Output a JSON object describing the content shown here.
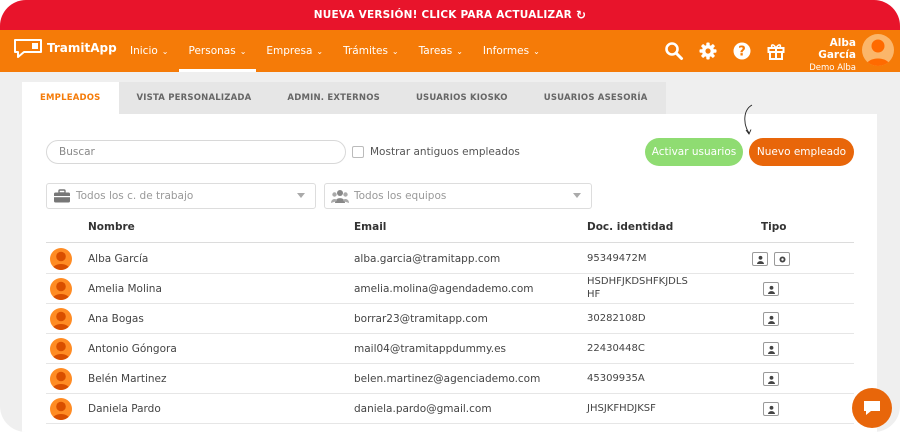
{
  "banner": {
    "text": "NUEVA VERSIÓN! CLICK PARA ACTUALIZAR",
    "icon": "refresh-icon"
  },
  "nav": {
    "logo_text": "TramitApp",
    "menu": [
      {
        "label": "Inicio"
      },
      {
        "label": "Personas",
        "active": true
      },
      {
        "label": "Empresa"
      },
      {
        "label": "Trámites"
      },
      {
        "label": "Tareas"
      },
      {
        "label": "Informes"
      }
    ],
    "icons": [
      "search-icon",
      "gear-icon",
      "help-icon",
      "gift-icon"
    ],
    "user": {
      "name": "Alba García",
      "company": "Demo Alba"
    }
  },
  "tabs": [
    {
      "label": "EMPLEADOS",
      "active": true
    },
    {
      "label": "VISTA PERSONALIZADA"
    },
    {
      "label": "ADMIN. EXTERNOS"
    },
    {
      "label": "USUARIOS KIOSKO"
    },
    {
      "label": "USUARIOS ASESORÍA"
    }
  ],
  "toolbar": {
    "search_placeholder": "Buscar",
    "checkbox_label": "Mostrar antiguos empleados",
    "activate_label": "Activar usuarios",
    "new_label": "Nuevo empleado"
  },
  "filters": {
    "workplace_placeholder": "Todos los c. de trabajo",
    "teams_placeholder": "Todos los equipos"
  },
  "table": {
    "headers": {
      "name": "Nombre",
      "email": "Email",
      "doc": "Doc. identidad",
      "type": "Tipo"
    },
    "rows": [
      {
        "name": "Alba García",
        "email": "alba.garcia@tramitapp.com",
        "doc": "95349472M",
        "doc2": "",
        "admin": true
      },
      {
        "name": "Amelia Molina",
        "email": "amelia.molina@agendademo.com",
        "doc": "HSDHFJKDSHFKJDLS",
        "doc2": "HF",
        "admin": false
      },
      {
        "name": "Ana Bogas",
        "email": "borrar23@tramitapp.com",
        "doc": "30282108D",
        "doc2": "",
        "admin": false
      },
      {
        "name": "Antonio Góngora",
        "email": "mail04@tramitappdummy.es",
        "doc": "22430448C",
        "doc2": "",
        "admin": false
      },
      {
        "name": "Belén Martinez",
        "email": "belen.martinez@agenciademo.com",
        "doc": "45309935A",
        "doc2": "",
        "admin": false
      },
      {
        "name": "Daniela Pardo",
        "email": "daniela.pardo@gmail.com",
        "doc": "JHSJKFHDJKSF",
        "doc2": "",
        "admin": false
      }
    ]
  },
  "colors": {
    "banner": "#e8142b",
    "nav": "#f57b08",
    "accent": "#e8660a",
    "green": "#8fdc72"
  }
}
